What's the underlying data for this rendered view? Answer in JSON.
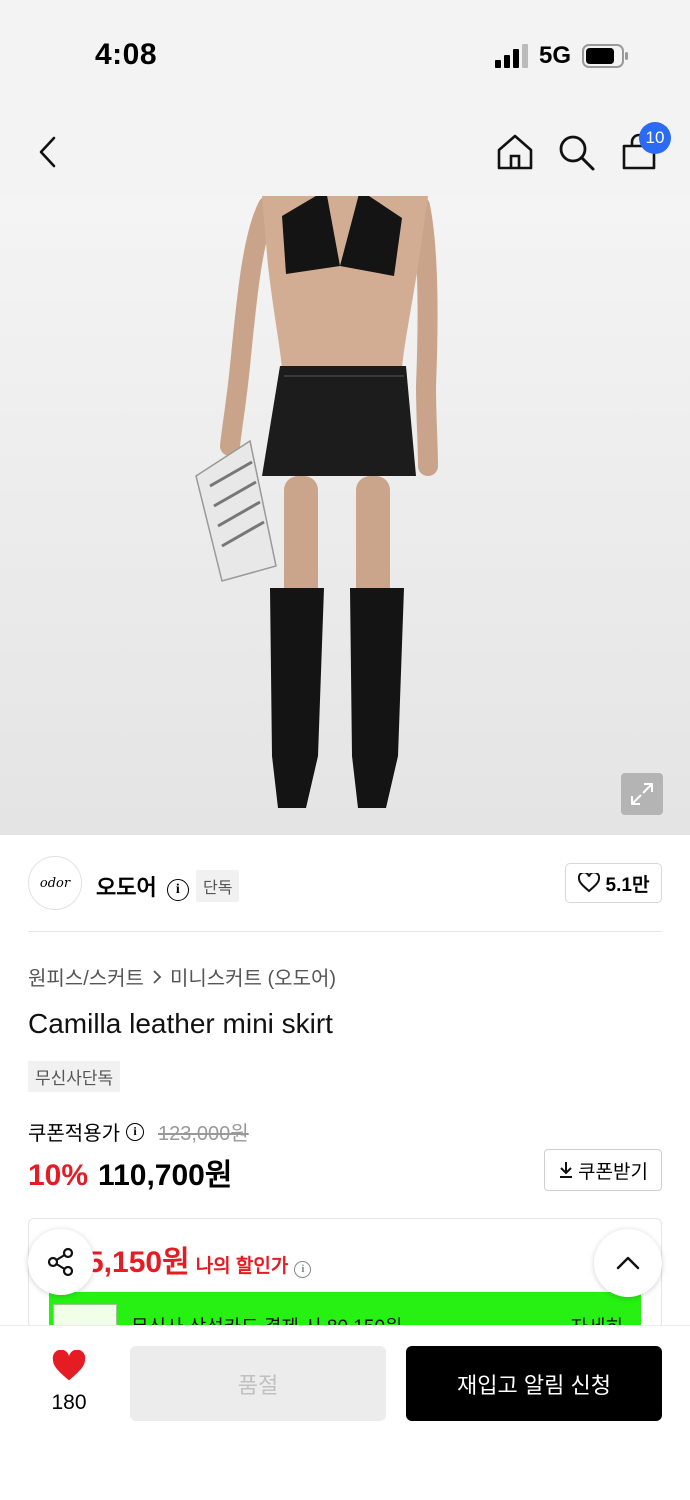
{
  "status": {
    "time": "4:08",
    "network": "5G"
  },
  "nav": {
    "cart_count": "10"
  },
  "brand": {
    "logo_text": "odor",
    "name": "오도어",
    "exclusive_tag": "단독",
    "likes": "5.1만"
  },
  "breadcrumb": {
    "category": "원피스/스커트",
    "subcategory": "미니스커트 (오도어)"
  },
  "product": {
    "title": "Camilla leather mini skirt",
    "tag": "무신사단독",
    "coupon_price_label": "쿠폰적용가",
    "original_price": "123,000원",
    "discount": "10%",
    "price": "110,700원",
    "coupon_button": "쿠폰받기"
  },
  "benefit": {
    "my_price": "5,150원",
    "my_price_label": "나의 할인가",
    "card_text": "무신사 삼성카드 결제 시 80,150원",
    "card_detail": "자세히"
  },
  "bottom": {
    "wish_count": "180",
    "soldout_label": "품절",
    "restock_label": "재입고 알림 신청"
  }
}
